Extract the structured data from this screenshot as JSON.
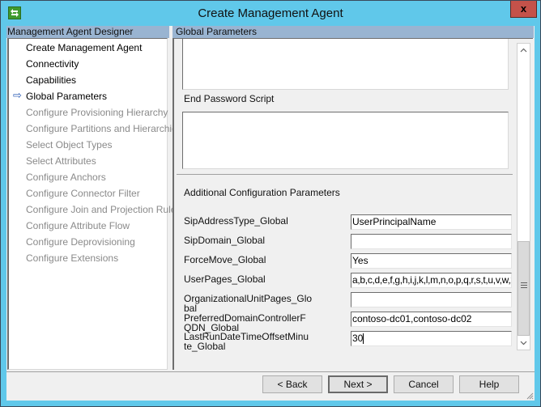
{
  "window": {
    "title": "Create Management Agent",
    "close_label": "x"
  },
  "left_panel": {
    "header": "Management Agent Designer",
    "current_indicator": "⇨",
    "items": [
      {
        "label": "Create Management Agent",
        "state": "enabled"
      },
      {
        "label": "Connectivity",
        "state": "enabled"
      },
      {
        "label": "Capabilities",
        "state": "enabled"
      },
      {
        "label": "Global Parameters",
        "state": "current"
      },
      {
        "label": "Configure Provisioning Hierarchy",
        "state": "disabled"
      },
      {
        "label": "Configure Partitions and Hierarchies",
        "state": "disabled"
      },
      {
        "label": "Select Object Types",
        "state": "disabled"
      },
      {
        "label": "Select Attributes",
        "state": "disabled"
      },
      {
        "label": "Configure Anchors",
        "state": "disabled"
      },
      {
        "label": "Configure Connector Filter",
        "state": "disabled"
      },
      {
        "label": "Configure Join and Projection Rules",
        "state": "disabled"
      },
      {
        "label": "Configure Attribute Flow",
        "state": "disabled"
      },
      {
        "label": "Configure Deprovisioning",
        "state": "disabled"
      },
      {
        "label": "Configure Extensions",
        "state": "disabled"
      }
    ]
  },
  "right_panel": {
    "header": "Global Parameters",
    "end_password_script_label": "End Password Script",
    "end_password_script_value": "",
    "additional_params_title": "Additional Configuration Parameters",
    "params": [
      {
        "label": "SipAddressType_Global",
        "value": "UserPrincipalName"
      },
      {
        "label": "SipDomain_Global",
        "value": ""
      },
      {
        "label": "ForceMove_Global",
        "value": "Yes"
      },
      {
        "label": "UserPages_Global",
        "value": "a,b,c,d,e,f,g,h,i,j,k,l,m,n,o,p,q,r,s,t,u,v,w,x"
      },
      {
        "label": "OrganizationalUnitPages_Global",
        "value": ""
      },
      {
        "label": "PreferredDomainControllerFQDN_Global",
        "value": "contoso-dc01,contoso-dc02"
      },
      {
        "label": "LastRunDateTimeOffsetMinute_Global",
        "value": "30"
      }
    ],
    "scrollbar": {
      "up_icon": "^",
      "down_icon": "v",
      "position_fraction": 0.85
    }
  },
  "buttons": {
    "back": "< Back",
    "next": "Next >",
    "cancel": "Cancel",
    "help": "Help"
  },
  "colors": {
    "title_bar": "#60c8ea",
    "panel_header": "#99b4d1",
    "close_button": "#c4524a",
    "current_arrow": "#2a5bb5"
  }
}
